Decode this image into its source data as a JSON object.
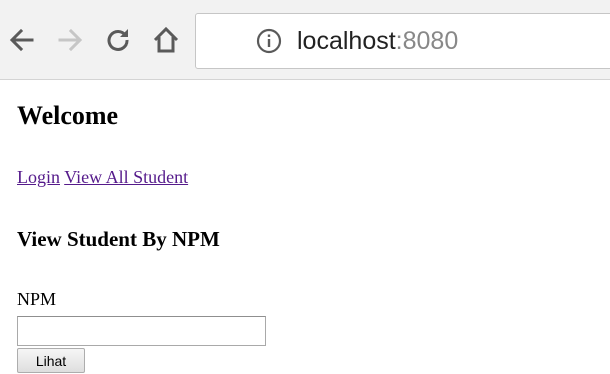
{
  "browser": {
    "url_host": "localhost",
    "url_port": ":8080",
    "icons": {
      "back": "back-arrow-icon",
      "forward": "forward-arrow-icon",
      "reload": "reload-icon",
      "home": "home-icon",
      "site_info": "info-icon"
    }
  },
  "page": {
    "title": "Welcome",
    "nav_links": {
      "login": "Login",
      "view_all": "View All Student"
    },
    "section_title": "View Student By NPM",
    "form": {
      "npm_label": "NPM",
      "npm_value": "",
      "npm_placeholder": "",
      "submit_label": "Lihat"
    }
  },
  "colors": {
    "toolbar_bg": "#f2f2f2",
    "link_visited": "#551a8b",
    "icon_active": "#5a5a5a",
    "icon_disabled": "#c6c6c6",
    "url_port": "#888888"
  }
}
